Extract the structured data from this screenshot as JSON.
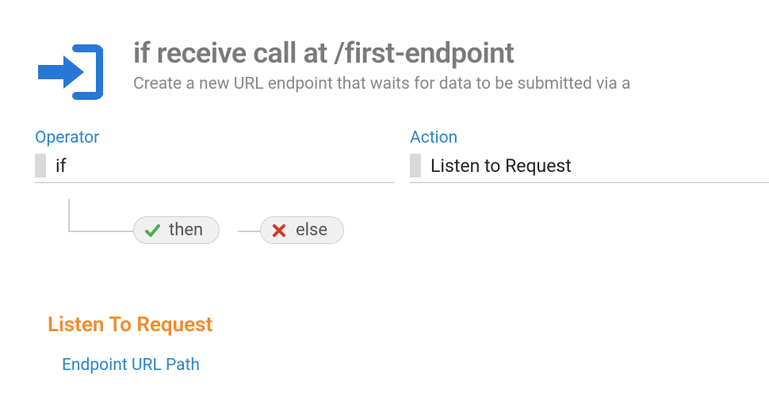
{
  "header": {
    "title": "if receive call at /first-endpoint",
    "description": "Create a new URL endpoint that waits for data to be submitted via a"
  },
  "fields": {
    "operator": {
      "label": "Operator",
      "value": "if"
    },
    "action": {
      "label": "Action",
      "value": "Listen to Request"
    }
  },
  "branches": {
    "then_label": "then",
    "else_label": "else"
  },
  "section": {
    "heading": "Listen To Request",
    "sub_label": "Endpoint URL Path"
  },
  "colors": {
    "primary_blue": "#2a84c9",
    "icon_blue": "#2876d6",
    "orange": "#f28a2d",
    "check_green": "#4bb04b",
    "x_red": "#d23a2a"
  }
}
